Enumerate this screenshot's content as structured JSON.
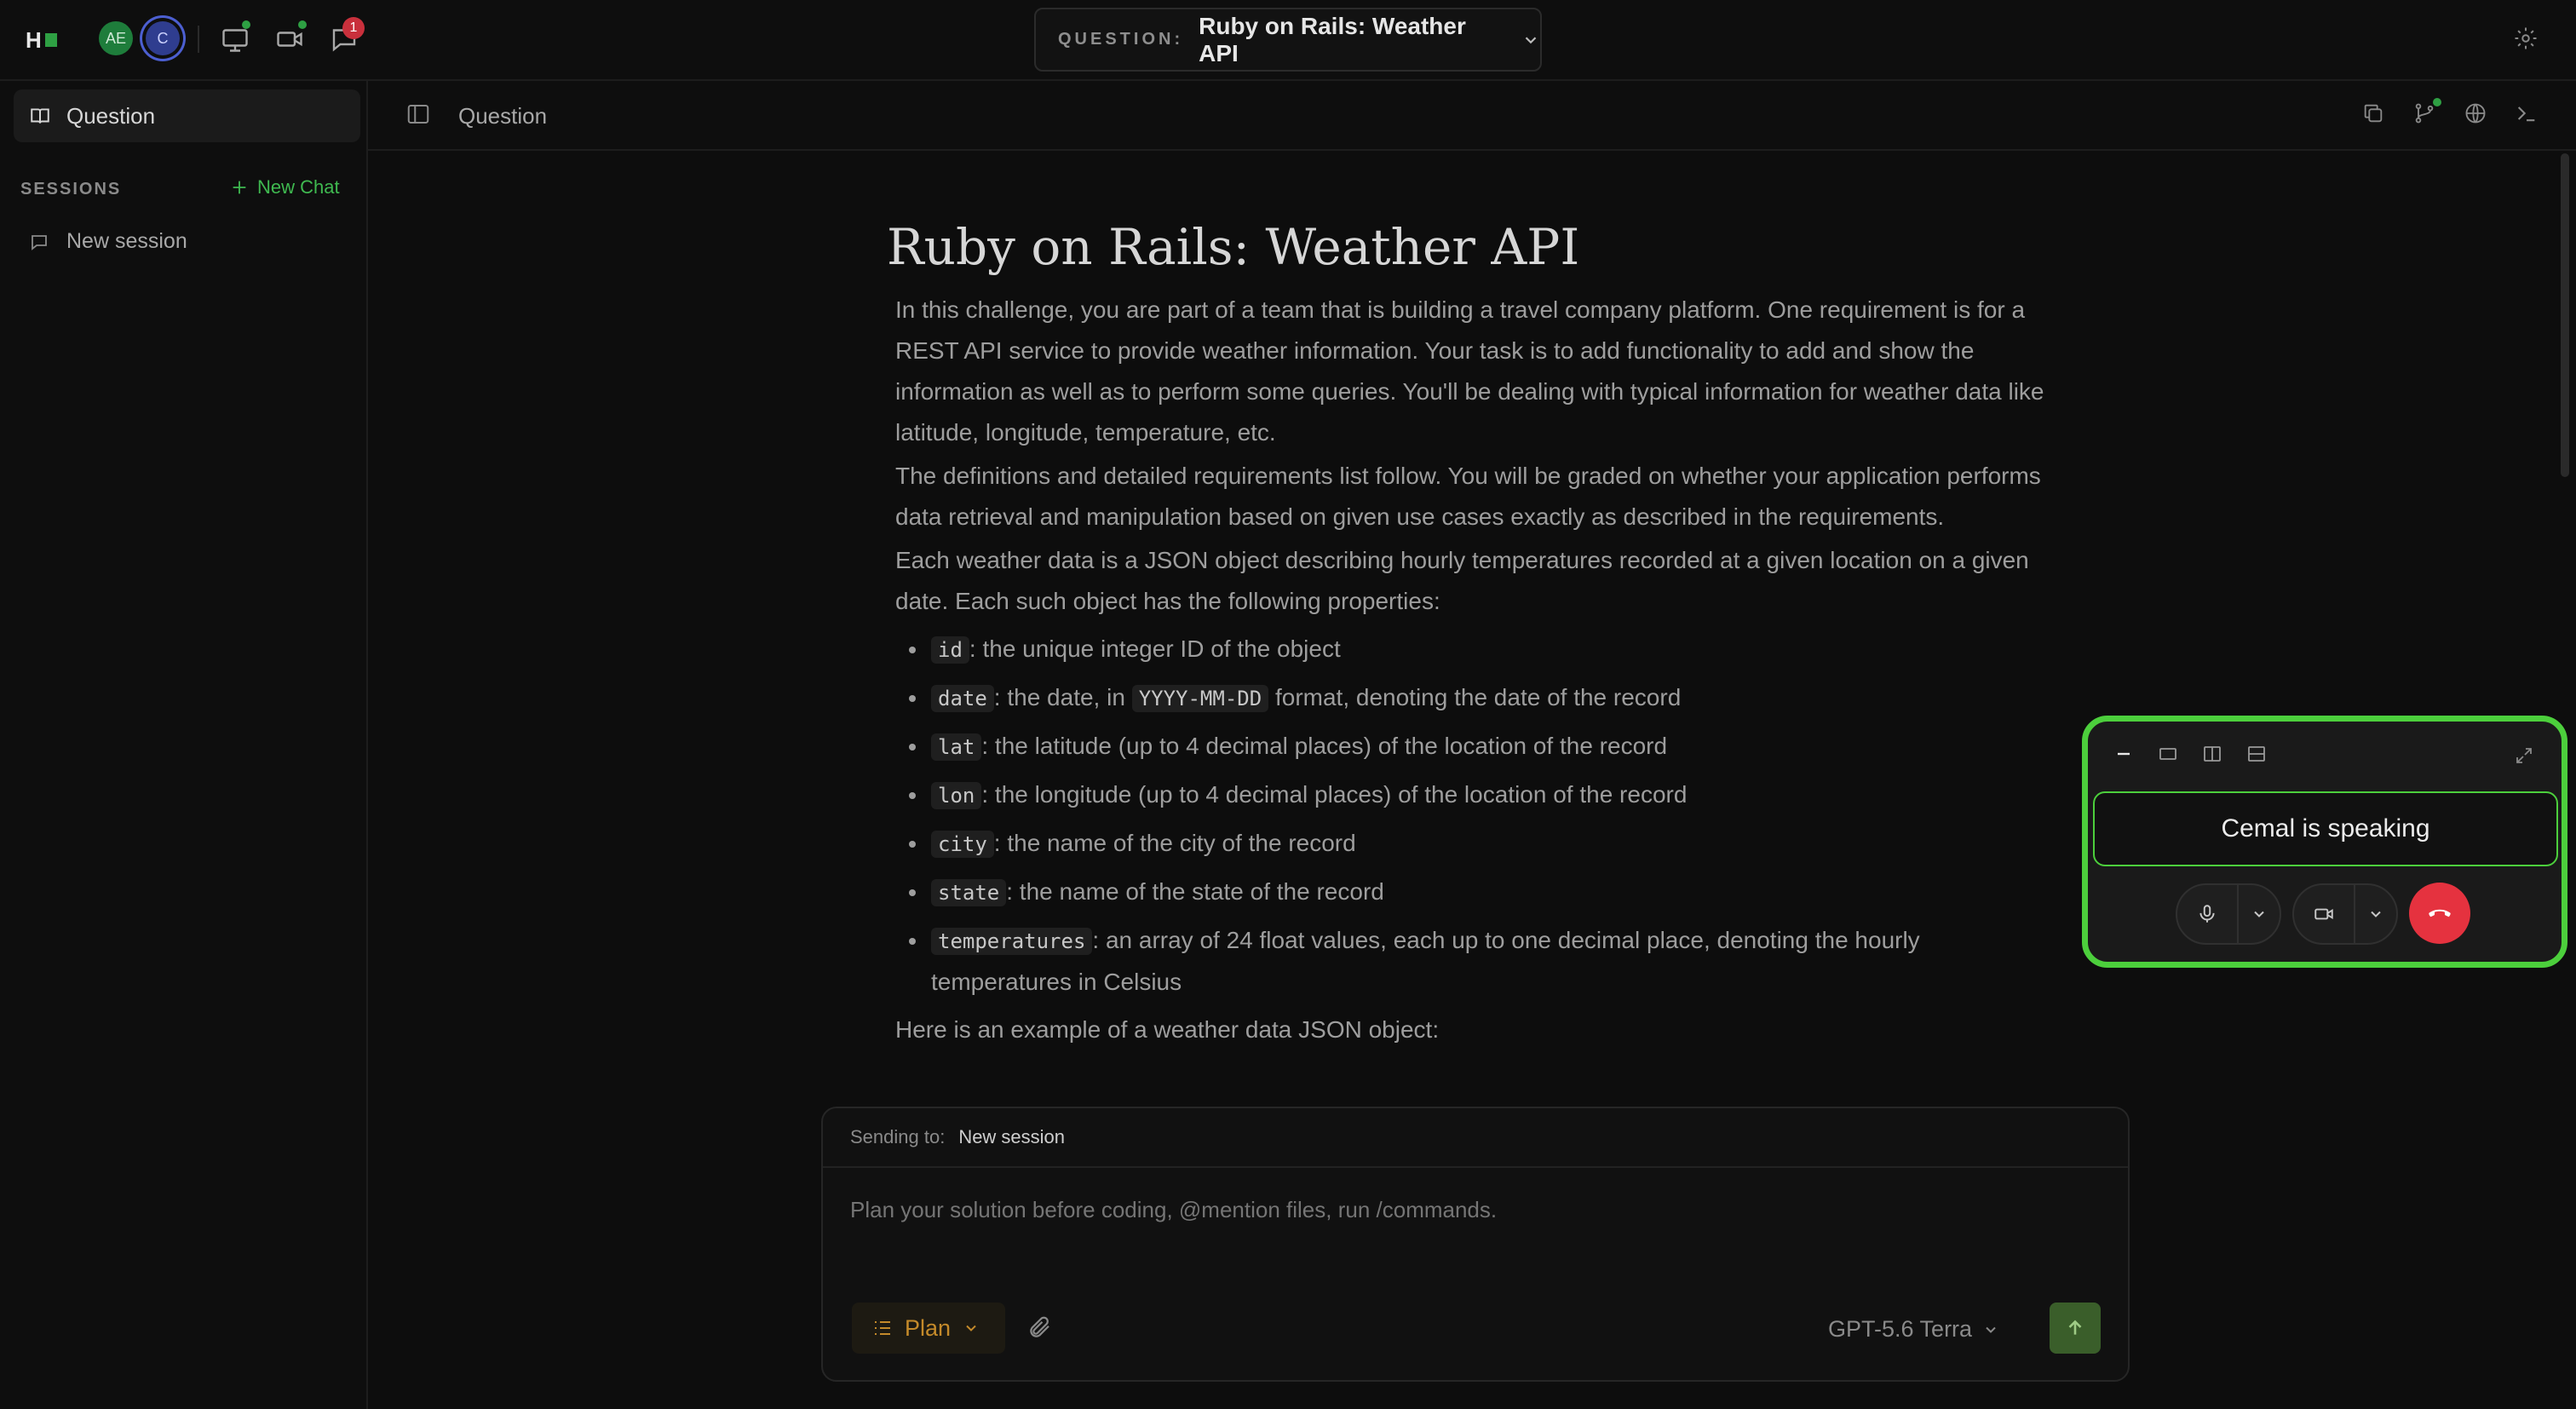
{
  "topbar": {
    "logo_text": "H",
    "avatars": [
      "AE",
      "C"
    ],
    "notifications_count": "1",
    "question_label": "QUESTION:",
    "question_title": "Ruby on Rails: Weather API"
  },
  "sidebar": {
    "question_label": "Question",
    "sessions_label": "SESSIONS",
    "new_chat_label": "New Chat",
    "sessions": [
      "New session"
    ]
  },
  "panel": {
    "title": "Question"
  },
  "content": {
    "title": "Ruby on Rails: Weather API",
    "p1": "In this challenge, you are part of a team that is building a travel company platform. One requirement is for a REST API service to provide weather information. Your task is to add functionality to add and show the information as well as to perform some queries. You'll be dealing with typical information for weather data like latitude, longitude, temperature, etc.",
    "p2": "The definitions and detailed requirements list follow. You will be graded on whether your application performs data retrieval and manipulation based on given use cases exactly as described in the requirements.",
    "p3": "Each weather data is a JSON object describing hourly temperatures recorded at a given location on a given date. Each such object has the following properties:",
    "props": [
      {
        "code": "id",
        "text": ": the unique integer ID of the object"
      },
      {
        "code": "date",
        "text_before": ": the date, in ",
        "code2": "YYYY-MM-DD",
        "text": " format, denoting the date of the record"
      },
      {
        "code": "lat",
        "text": ": the latitude (up to 4 decimal places) of the location of the record"
      },
      {
        "code": "lon",
        "text": ": the longitude (up to 4 decimal places) of the location of the record"
      },
      {
        "code": "city",
        "text": ": the name of the city of the record"
      },
      {
        "code": "state",
        "text": ": the name of the state of the record"
      },
      {
        "code": "temperatures",
        "text": ": an array of 24 float values, each up to one decimal place, denoting the hourly temperatures in Celsius"
      }
    ],
    "p4": "Here is an example of a weather data JSON object:"
  },
  "composer": {
    "sending_to_label": "Sending to:",
    "sending_to_value": "New session",
    "placeholder": "Plan your solution before coding, @mention files, run /commands.",
    "mode_label": "Plan",
    "model_label": "GPT-5.6 Terra"
  },
  "call": {
    "status": "Cemal is speaking"
  },
  "colors": {
    "accent_green": "#3fb950",
    "highlight_border": "#4ccf3c",
    "hangup_red": "#e5323f",
    "plan_orange": "#c48a2a"
  }
}
